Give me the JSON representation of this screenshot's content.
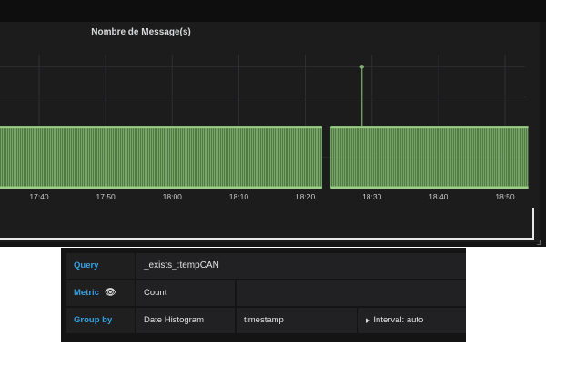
{
  "panel": {
    "title": "Nombre de Message(s)"
  },
  "chart_data": {
    "type": "bar",
    "title": "Nombre de Message(s)",
    "x_ticks": [
      "17:40",
      "17:50",
      "18:00",
      "18:10",
      "18:20",
      "18:30",
      "18:40",
      "18:50"
    ],
    "x_ticks_minutes": [
      1060,
      1070,
      1080,
      1090,
      1100,
      1110,
      1120,
      1130
    ],
    "segments": [
      {
        "start_minutes": 1033,
        "end_minutes": 1102.5,
        "value": 1
      },
      {
        "start_minutes": 1103.8,
        "end_minutes": 1133.5,
        "value": 1
      }
    ],
    "spike": {
      "time_minutes": 1108.5,
      "value": 2
    },
    "ylim": [
      0,
      2.2
    ],
    "grid": true,
    "color": "#7eb26d"
  },
  "query_editor": {
    "query_label": "Query",
    "query_value": "_exists_:tempCAN",
    "metric_label": "Metric",
    "metric_value": "Count",
    "group_label": "Group by",
    "group_type": "Date Histogram",
    "group_field": "timestamp",
    "group_interval": "Interval: auto"
  },
  "colors": {
    "background": "#141414",
    "label": "#33a2e5",
    "series": "#7eb26d"
  }
}
